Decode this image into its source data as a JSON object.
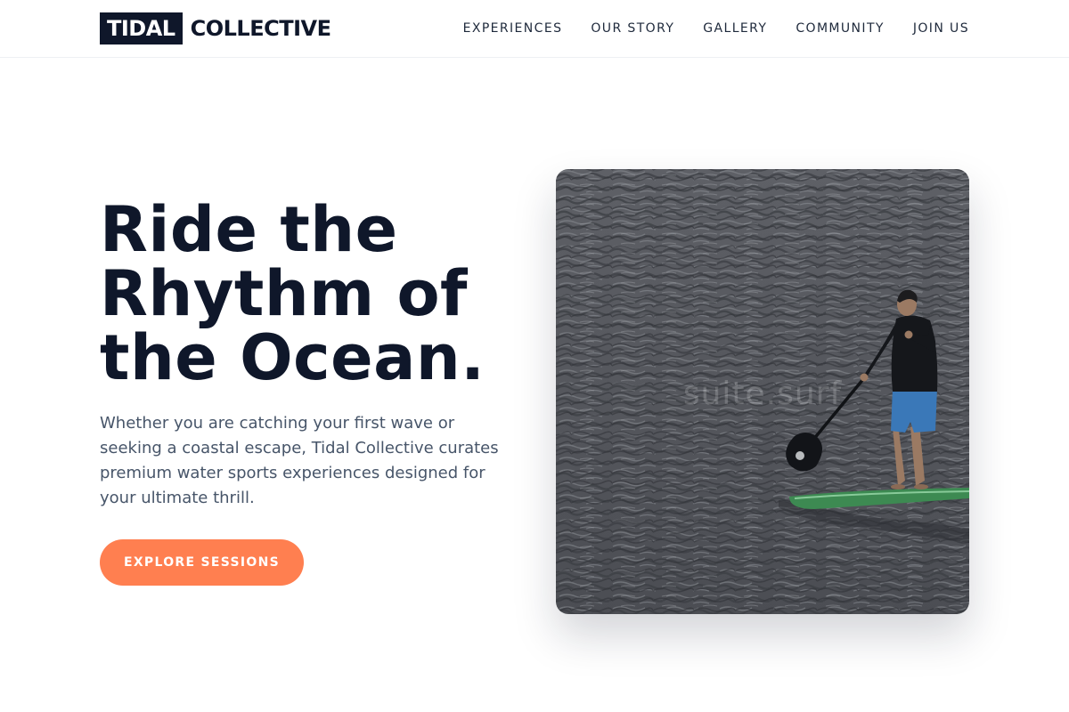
{
  "brand": {
    "logo_box": "TIDAL",
    "logo_rest": "COLLECTIVE"
  },
  "nav": {
    "items": [
      {
        "label": "EXPERIENCES"
      },
      {
        "label": "OUR STORY"
      },
      {
        "label": "GALLERY"
      },
      {
        "label": "COMMUNITY"
      },
      {
        "label": "JOIN US"
      }
    ]
  },
  "hero": {
    "title_lines": [
      "Ride the",
      "Rhythm of",
      "the Ocean."
    ],
    "subtitle": "Whether you are catching your first wave or seeking a coastal escape, Tidal Collective curates premium water sports experiences designed for your ultimate thrill.",
    "cta_label": "EXPLORE SESSIONS",
    "image_watermark": "suite.surf"
  },
  "colors": {
    "navy": "#0f172a",
    "accent": "#ff7f50",
    "text_muted": "#475569"
  }
}
